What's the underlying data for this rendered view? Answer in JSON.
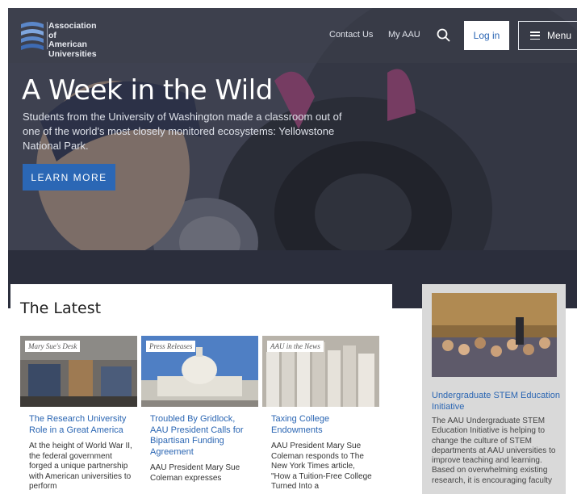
{
  "header": {
    "logo_lines": [
      "Association",
      "of American",
      "Universities"
    ],
    "nav": {
      "contact": "Contact Us",
      "myaau": "My AAU"
    },
    "login_label": "Log in",
    "menu_label": "Menu"
  },
  "hero": {
    "title": "A Week in the Wild",
    "description": "Students from the University of Washington made a classroom out of one of the world's most closely monitored ecosystems: Yellowstone National Park.",
    "button_label": "LEARN MORE"
  },
  "latest": {
    "heading": "The Latest",
    "cards": [
      {
        "tag": "Mary Sue's Desk",
        "title": "The Research University Role in a Great America",
        "body": "At the height of World War II, the federal government forged a unique partnership with American universities to perform"
      },
      {
        "tag": "Press Releases",
        "title": "Troubled By Gridlock, AAU President Calls for Bipartisan Funding Agreement",
        "body": "AAU President Mary Sue Coleman expresses"
      },
      {
        "tag": "AAU in the News",
        "title": "Taxing College Endowments",
        "body": "AAU President Mary Sue Coleman responds to The New York Times article, \"How a Tuition-Free College Turned Into a"
      }
    ]
  },
  "sidebar": {
    "title": "Undergraduate STEM Education Initiative",
    "body": "The AAU Undergraduate STEM Education Initiative is helping to change the culture of STEM departments at AAU universities to improve teaching and learning. Based on overwhelming existing research, it is encouraging faculty"
  },
  "colors": {
    "accent": "#2b67b5",
    "link": "#2b66b3",
    "sidebar_bg": "#d9d9d9"
  },
  "icons": {
    "search": "search-icon",
    "menu": "hamburger-icon"
  }
}
